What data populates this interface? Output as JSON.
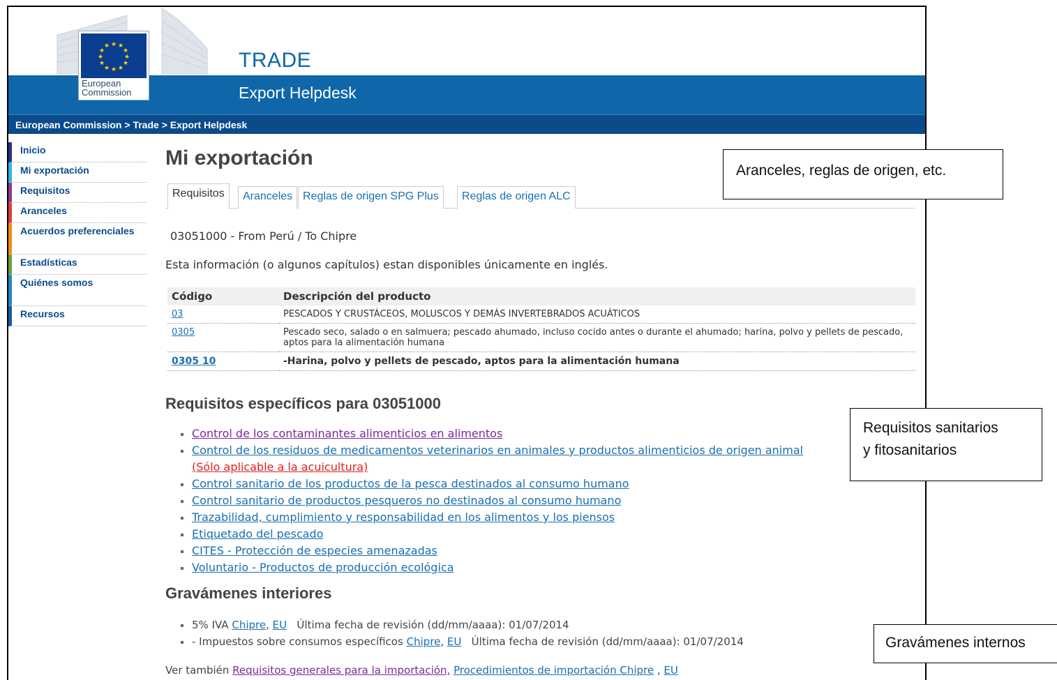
{
  "header": {
    "site_title": "TRADE",
    "site_subtitle": "Export Helpdesk",
    "logo_text_1": "European",
    "logo_text_2": "Commission",
    "breadcrumb": [
      "European Commission",
      "Trade",
      "Export Helpdesk"
    ],
    "breadcrumb_sep": ">"
  },
  "sidebar": {
    "items": [
      {
        "label": "Inicio"
      },
      {
        "label": "Mi exportación"
      },
      {
        "label": "Requisitos"
      },
      {
        "label": "Aranceles"
      },
      {
        "label": "Acuerdos preferenciales"
      },
      {
        "label": "Estadísticas"
      },
      {
        "label": "Quiénes somos"
      },
      {
        "label": "Recursos"
      }
    ]
  },
  "main": {
    "title": "Mi exportación",
    "tabs": [
      {
        "label": "Requisitos",
        "active": true
      },
      {
        "label": "Aranceles"
      },
      {
        "label": "Reglas de origen SPG Plus"
      },
      {
        "label": "Reglas de origen ALC"
      }
    ],
    "product_line": "03051000 - From Perú / To Chipre",
    "notice": "Esta información (o algunos capítulos) estan disponibles únicamente en inglés.",
    "table": {
      "headers": [
        "Código",
        "Descripción del producto"
      ],
      "rows": [
        {
          "code": "03",
          "desc": "PESCADOS Y CRUSTÁCEOS, MOLUSCOS Y DEMÁS INVERTEBRADOS ACUÁTICOS"
        },
        {
          "code": "0305",
          "desc": "Pescado seco, salado o en salmuera; pescado ahumado, incluso cocido antes o durante el ahumado; harina, polvo y pellets de pescado, aptos para la alimentación humana"
        },
        {
          "code": "0305 10",
          "desc": "-Harina, polvo y pellets de pescado, aptos para la alimentación humana"
        }
      ]
    },
    "specific_heading": "Requisitos específicos para 03051000",
    "requirements": [
      "Control de los contaminantes alimenticios en alimentos",
      "Control de los residuos de medicamentos veterinarios en animales y productos alimenticios de origen animal",
      "Control sanitario de los productos de la pesca destinados al consumo humano",
      "Control sanitario de productos pesqueros no destinados al consumo humano",
      "Trazabilidad, cumplimiento y responsabilidad en los alimentos y los piensos",
      "Etiquetado del pescado",
      "CITES - Protección de especies amenazadas",
      "Voluntario - Productos de producción ecológica"
    ],
    "aquaculture_note": "(Sólo aplicable a la acuicultura)",
    "internal_heading": "Gravámenes interiores",
    "gravamenes": [
      {
        "prefix": "5% IVA",
        "link1": "Chipre",
        "link2": "EU",
        "review": "Última fecha de revisión (dd/mm/aaaa): 01/07/2014"
      },
      {
        "prefix": "- Impuestos sobre consumos específicos",
        "link1": "Chipre",
        "link2": "EU",
        "review": "Última fecha de revisión (dd/mm/aaaa): 01/07/2014"
      }
    ],
    "see_also": {
      "prefix": "Ver también",
      "link1": "Requisitos generales para la importación,",
      "link2": "Procedimientos de importación Chipre",
      "link3": "EU"
    }
  },
  "callouts": {
    "aranceles": "Aranceles, reglas de origen, etc.",
    "sanitarios_1": "Requisitos sanitarios",
    "sanitarios_2": "y fitosanitarios",
    "gravamenes": "Gravámenes internos"
  },
  "colors": {
    "brand_blue": "#0f66a8",
    "breadcrumb_blue": "#0b4b8a",
    "link": "#1a6fb0",
    "visited": "#7a2a9a",
    "alert_red": "#e02020"
  }
}
